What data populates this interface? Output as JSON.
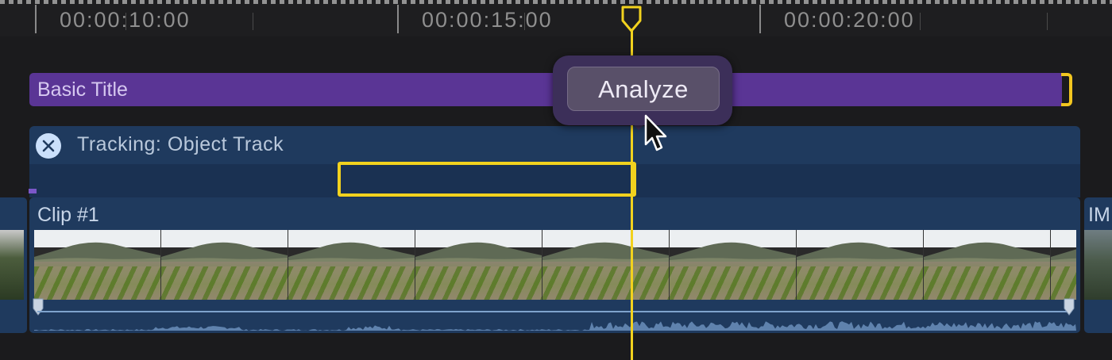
{
  "ruler": {
    "timecodes": [
      "00:00:10:00",
      "00:00:15:00",
      "00:00:20:00"
    ]
  },
  "title_clip": {
    "label": "Basic Title"
  },
  "tracking": {
    "label": "Tracking: Object Track",
    "close_icon": "close-icon"
  },
  "popover": {
    "analyze_label": "Analyze"
  },
  "clip": {
    "label": "Clip #1"
  },
  "next_clip": {
    "label": "IM"
  },
  "colors": {
    "title_clip": "#5a3595",
    "tracking_panel": "#1f3a5e",
    "playhead": "#f2d21e",
    "popover": "#3c2f59"
  }
}
